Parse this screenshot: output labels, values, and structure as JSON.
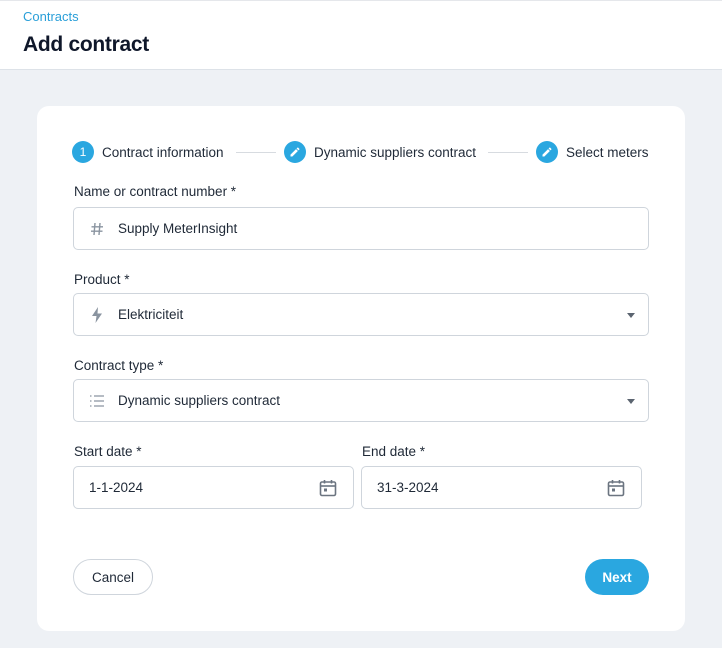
{
  "header": {
    "breadcrumb": "Contracts",
    "title": "Add contract"
  },
  "stepper": {
    "steps": [
      {
        "marker": "1",
        "label": "Contract information",
        "state": "active",
        "icon": "number"
      },
      {
        "marker": "",
        "label": "Dynamic suppliers contract",
        "state": "pending",
        "icon": "pencil-icon"
      },
      {
        "marker": "",
        "label": "Select meters",
        "state": "pending",
        "icon": "pencil-icon"
      }
    ]
  },
  "form": {
    "name": {
      "label": "Name or contract number *",
      "value": "Supply MeterInsight",
      "icon": "hash-icon"
    },
    "product": {
      "label": "Product *",
      "value": "Elektriciteit",
      "icon": "lightning-icon"
    },
    "contract_type": {
      "label": "Contract type *",
      "value": "Dynamic suppliers contract",
      "icon": "list-icon"
    },
    "start_date": {
      "label": "Start date *",
      "value": "1-1-2024",
      "icon": "calendar-icon"
    },
    "end_date": {
      "label": "End date *",
      "value": "31-3-2024",
      "icon": "calendar-icon"
    }
  },
  "actions": {
    "cancel_label": "Cancel",
    "next_label": "Next"
  },
  "colors": {
    "accent": "#2aa7e0",
    "breadcrumb": "#2a9fd8",
    "background": "#eef1f5"
  }
}
